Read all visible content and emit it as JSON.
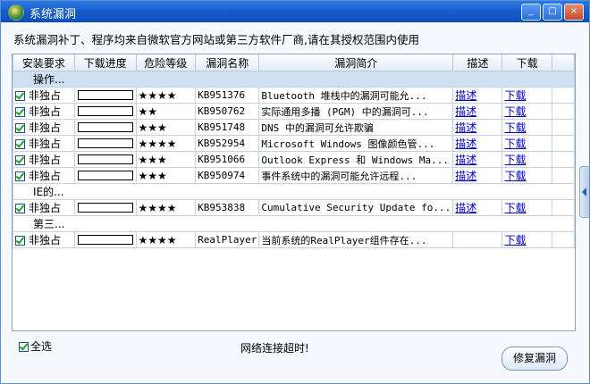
{
  "window": {
    "title": "系统漏洞"
  },
  "intro_text": "系统漏洞补丁、程序均来自微软官方网站或第三方软件厂商,请在其授权范围内使用",
  "columns": [
    "安装要求",
    "下载进度",
    "危险等级",
    "漏洞名称",
    "漏洞简介",
    "描述",
    "下载"
  ],
  "groups": [
    {
      "label": "操作...",
      "rows": [
        {
          "req": "非独占",
          "stars": "★★★★",
          "name": "KB951376",
          "desc": "Bluetooth 堆栈中的漏洞可能允...",
          "desc_link": "描述",
          "dl_link": "下载"
        },
        {
          "req": "非独占",
          "stars": "★★",
          "name": "KB950762",
          "desc": "实际通用多播 (PGM) 中的漏洞可...",
          "desc_link": "描述",
          "dl_link": "下载"
        },
        {
          "req": "非独占",
          "stars": "★★★",
          "name": "KB951748",
          "desc": "DNS 中的漏洞可允许欺骗",
          "desc_link": "描述",
          "dl_link": "下载"
        },
        {
          "req": "非独占",
          "stars": "★★★★",
          "name": "KB952954",
          "desc": "Microsoft Windows 图像颜色管...",
          "desc_link": "描述",
          "dl_link": "下载"
        },
        {
          "req": "非独占",
          "stars": "★★★",
          "name": "KB951066",
          "desc": "Outlook Express 和 Windows Ma...",
          "desc_link": "描述",
          "dl_link": "下载"
        },
        {
          "req": "非独占",
          "stars": "★★★",
          "name": "KB950974",
          "desc": "事件系统中的漏洞可能允许远程...",
          "desc_link": "描述",
          "dl_link": "下载"
        }
      ]
    },
    {
      "label": "IE的...",
      "rows": [
        {
          "req": "非独占",
          "stars": "★★★★",
          "name": "KB953838",
          "desc": "Cumulative Security Update fo...",
          "desc_link": "描述",
          "dl_link": "下载"
        }
      ]
    },
    {
      "label": "第三...",
      "rows": [
        {
          "req": "非独占",
          "stars": "★★★★",
          "name": "RealPlayer",
          "desc": "当前系统的RealPlayer组件存在...",
          "desc_link": "",
          "dl_link": "下载"
        }
      ]
    }
  ],
  "select_all_label": "全选",
  "status_text": "网络连接超时!",
  "fix_button": "修复漏洞",
  "colors": {
    "title_bar": "#1659c8",
    "link": "#0000cc",
    "star": "#000000"
  }
}
